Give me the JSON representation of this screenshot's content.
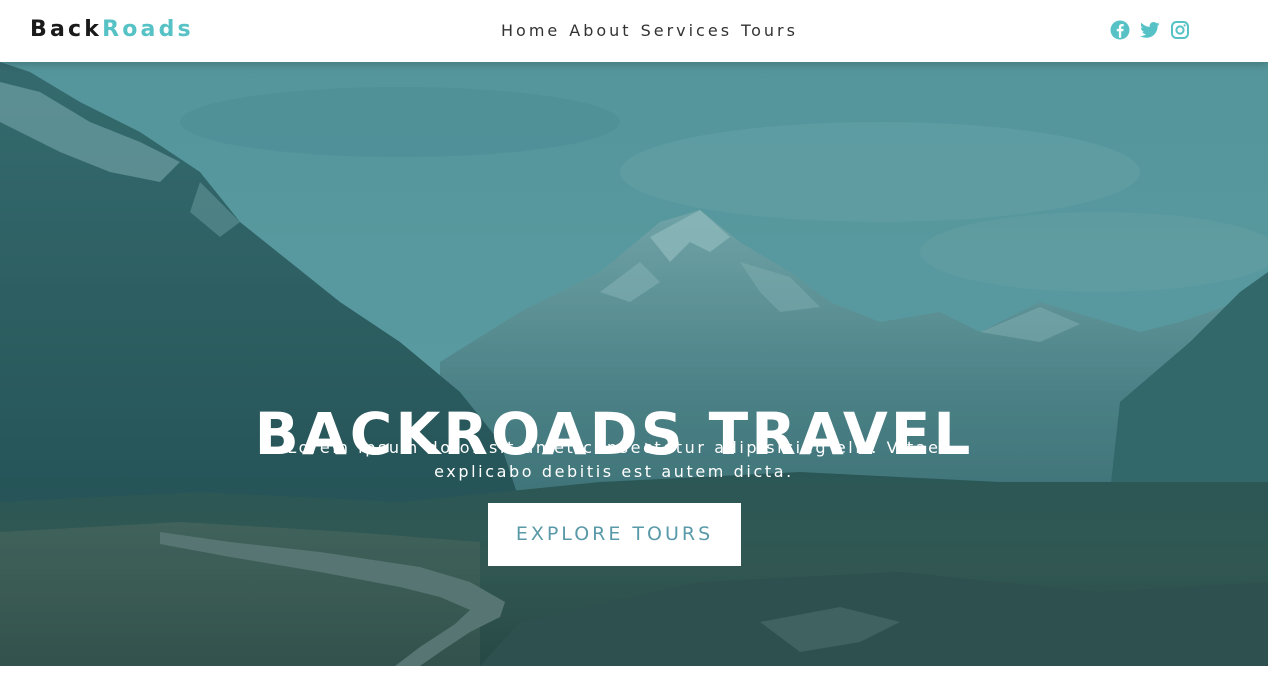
{
  "logo": {
    "part1": "Back",
    "part2": "Roads"
  },
  "nav": {
    "links": [
      "Home",
      "About",
      "Services",
      "Tours"
    ]
  },
  "social": {
    "icons": [
      "facebook-icon",
      "twitter-icon",
      "instagram-icon"
    ],
    "color": "#56c2c6"
  },
  "hero": {
    "title": "BACKROADS TRAVEL",
    "text": "Lorem ipsum dolor sit amet consectetur adipisicing elit. Vitae explicabo debitis est autem dicta.",
    "button_label": "EXPLORE TOURS",
    "overlay_color": "#2d8c93"
  },
  "colors": {
    "brand_dark": "#1a1a1a",
    "brand_accent": "#56c2c6",
    "button_text": "#5a9aa8"
  }
}
